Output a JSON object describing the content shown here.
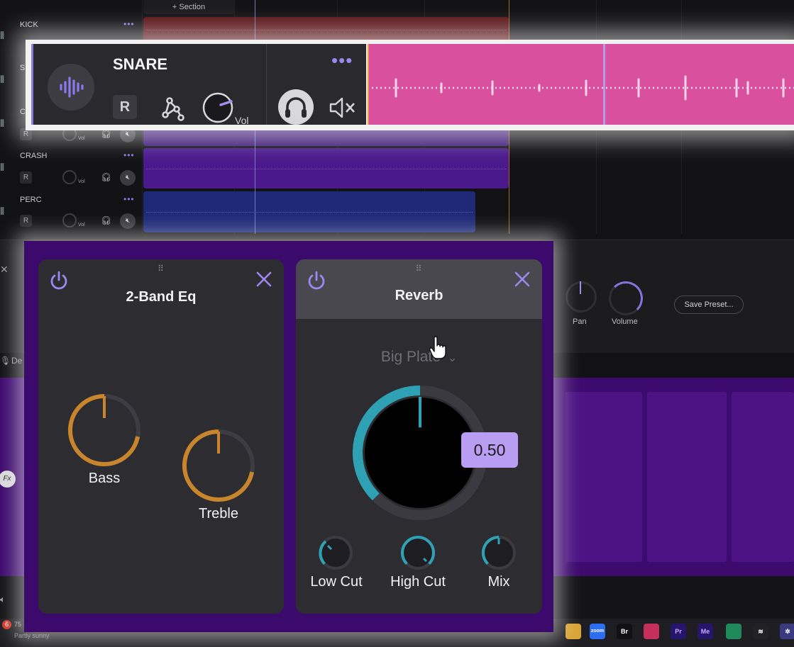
{
  "background": {
    "section_button": "+ Section",
    "tracks": [
      {
        "name": "KICK"
      },
      {
        "name": "SN"
      },
      {
        "name": "CL"
      },
      {
        "name": "CRASH"
      },
      {
        "name": "PERC"
      }
    ],
    "more_label": "•••",
    "record_label": "R",
    "vol_label": "Vol",
    "pan_label": "Pan",
    "volume_label": "Volume",
    "save_preset_label": "Save Preset...",
    "close_label": "✕",
    "fx_label": "Fx",
    "de_label": "De"
  },
  "snare_panel": {
    "title": "SNARE",
    "more_label": "•••",
    "record_label": "R",
    "vol_label": "Vol"
  },
  "fx_chain": {
    "eq": {
      "title": "2-Band Eq",
      "bass_label": "Bass",
      "treble_label": "Treble",
      "bass_level": 0.72,
      "treble_level": 0.72
    },
    "reverb": {
      "title": "Reverb",
      "preset": "Big Plate",
      "main_value": "0.50",
      "low_cut_label": "Low Cut",
      "high_cut_label": "High Cut",
      "mix_label": "Mix"
    }
  },
  "taskbar": {
    "notification_count": "6",
    "weather_temp": "75",
    "weather_text": "Partly sunny",
    "apps": [
      "zoom",
      "Br",
      "Cc",
      "Pr",
      "Me",
      "chat",
      "capcut",
      "app"
    ]
  },
  "colors": {
    "accent": "#8c7ae6",
    "eq_knob": "#c8852c",
    "reverb_knob": "#2fa1b5",
    "snare_clip": "#d9509e",
    "fx_bg": "#3c0a6c"
  }
}
